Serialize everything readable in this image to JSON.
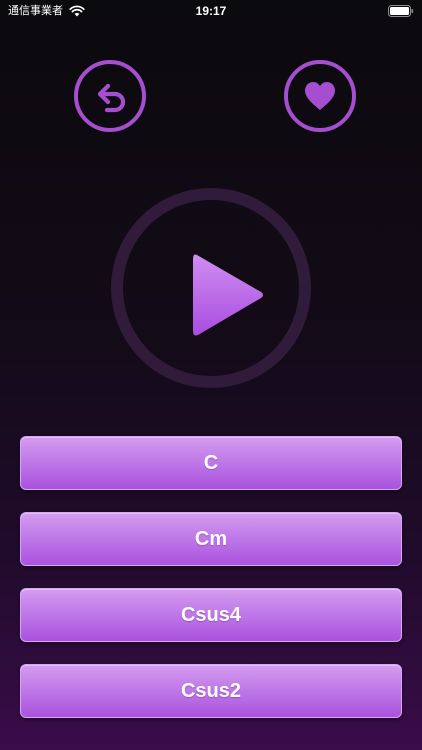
{
  "status_bar": {
    "carrier": "通信事業者",
    "time": "19:17"
  },
  "icons": {
    "back": "undo-arrow-icon",
    "favorite": "heart-icon",
    "play": "play-icon"
  },
  "colors": {
    "accent": "#a54fd0",
    "ring": "#301b3a",
    "button_top": "#d59cf0",
    "button_bottom": "#aa52df"
  },
  "answers": [
    {
      "label": "C"
    },
    {
      "label": "Cm"
    },
    {
      "label": "Csus4"
    },
    {
      "label": "Csus2"
    }
  ]
}
